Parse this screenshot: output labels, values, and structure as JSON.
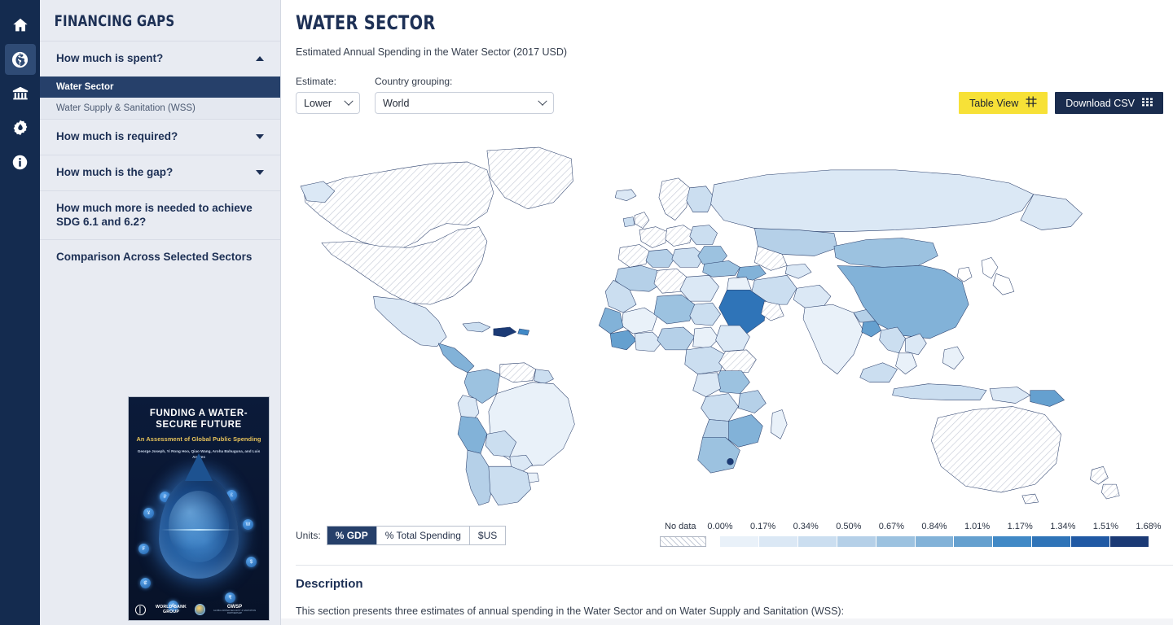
{
  "rail": {
    "items": [
      {
        "name": "home-icon",
        "label": "Home",
        "active": false
      },
      {
        "name": "globe-icon",
        "label": "Global Data",
        "active": true
      },
      {
        "name": "institution-icon",
        "label": "Institutions",
        "active": false
      },
      {
        "name": "water-gear-icon",
        "label": "Water Settings",
        "active": false
      },
      {
        "name": "info-icon",
        "label": "Information",
        "active": false
      }
    ]
  },
  "sidebar": {
    "title": "FINANCING GAPS",
    "groups": [
      {
        "label": "How much is spent?",
        "expanded": true,
        "caret": "up",
        "children": [
          {
            "label": "Water Sector",
            "selected": true
          },
          {
            "label": "Water Supply & Sanitation (WSS)",
            "selected": false
          }
        ]
      },
      {
        "label": "How much is required?",
        "expanded": false,
        "caret": "down",
        "children": []
      },
      {
        "label": "How much is the gap?",
        "expanded": false,
        "caret": "down",
        "children": []
      },
      {
        "label": "How much more is needed to achieve SDG 6.1 and 6.2?",
        "expanded": false,
        "caret": "none",
        "children": []
      },
      {
        "label": "Comparison Across Selected Sectors",
        "expanded": false,
        "caret": "none",
        "children": []
      }
    ],
    "cover": {
      "title": "FUNDING A WATER-SECURE FUTURE",
      "subtitle": "An Assessment of Global Public Spending",
      "authors": "George Joseph, Yi Rong Hoo, Qiao Wang, Aroha Bahuguna, and Luis Andres",
      "publisher": "WORLD BANK GROUP",
      "partner": "GWSP",
      "partner_sub": "GLOBAL WATER SECURITY & SANITATION PARTNERSHIP"
    }
  },
  "main": {
    "title": "WATER SECTOR",
    "subtitle": "Estimated Annual Spending in the Water Sector (2017 USD)",
    "controls": {
      "estimate_label": "Estimate:",
      "estimate_value": "Lower",
      "grouping_label": "Country grouping:",
      "grouping_value": "World"
    },
    "buttons": {
      "table_view": "Table View",
      "download_csv": "Download CSV"
    },
    "units": {
      "label": "Units:",
      "options": [
        {
          "label": "% GDP",
          "selected": true
        },
        {
          "label": "% Total Spending",
          "selected": false
        },
        {
          "label": "$US",
          "selected": false
        }
      ]
    },
    "description": {
      "heading": "Description",
      "paragraph": "This section presents three estimates of annual spending in the Water Sector and on Water Supply and Sanitation (WSS):"
    }
  },
  "chart_data": {
    "type": "heatmap",
    "title": "Estimated Annual Spending in the Water Sector (2017 USD)",
    "unit": "% GDP",
    "no_data_label": "No data",
    "legend_position": "bottom-right",
    "tick_labels": [
      "0.00%",
      "0.17%",
      "0.34%",
      "0.50%",
      "0.67%",
      "0.84%",
      "1.01%",
      "1.17%",
      "1.34%",
      "1.51%",
      "1.68%"
    ],
    "tick_values": [
      0.0,
      0.17,
      0.34,
      0.5,
      0.67,
      0.84,
      1.01,
      1.17,
      1.34,
      1.51,
      1.68
    ],
    "range": [
      0.0,
      1.68
    ],
    "colors": [
      "#e9f1f9",
      "#dbe8f5",
      "#cbdef0",
      "#b5d0e8",
      "#9cc2e0",
      "#82b2d8",
      "#65a0cf",
      "#4189c6",
      "#2f74b8",
      "#2059a4",
      "#1b3a75"
    ],
    "no_data_color": "#ffffff",
    "no_data_pattern": "diagonal-hatch"
  }
}
